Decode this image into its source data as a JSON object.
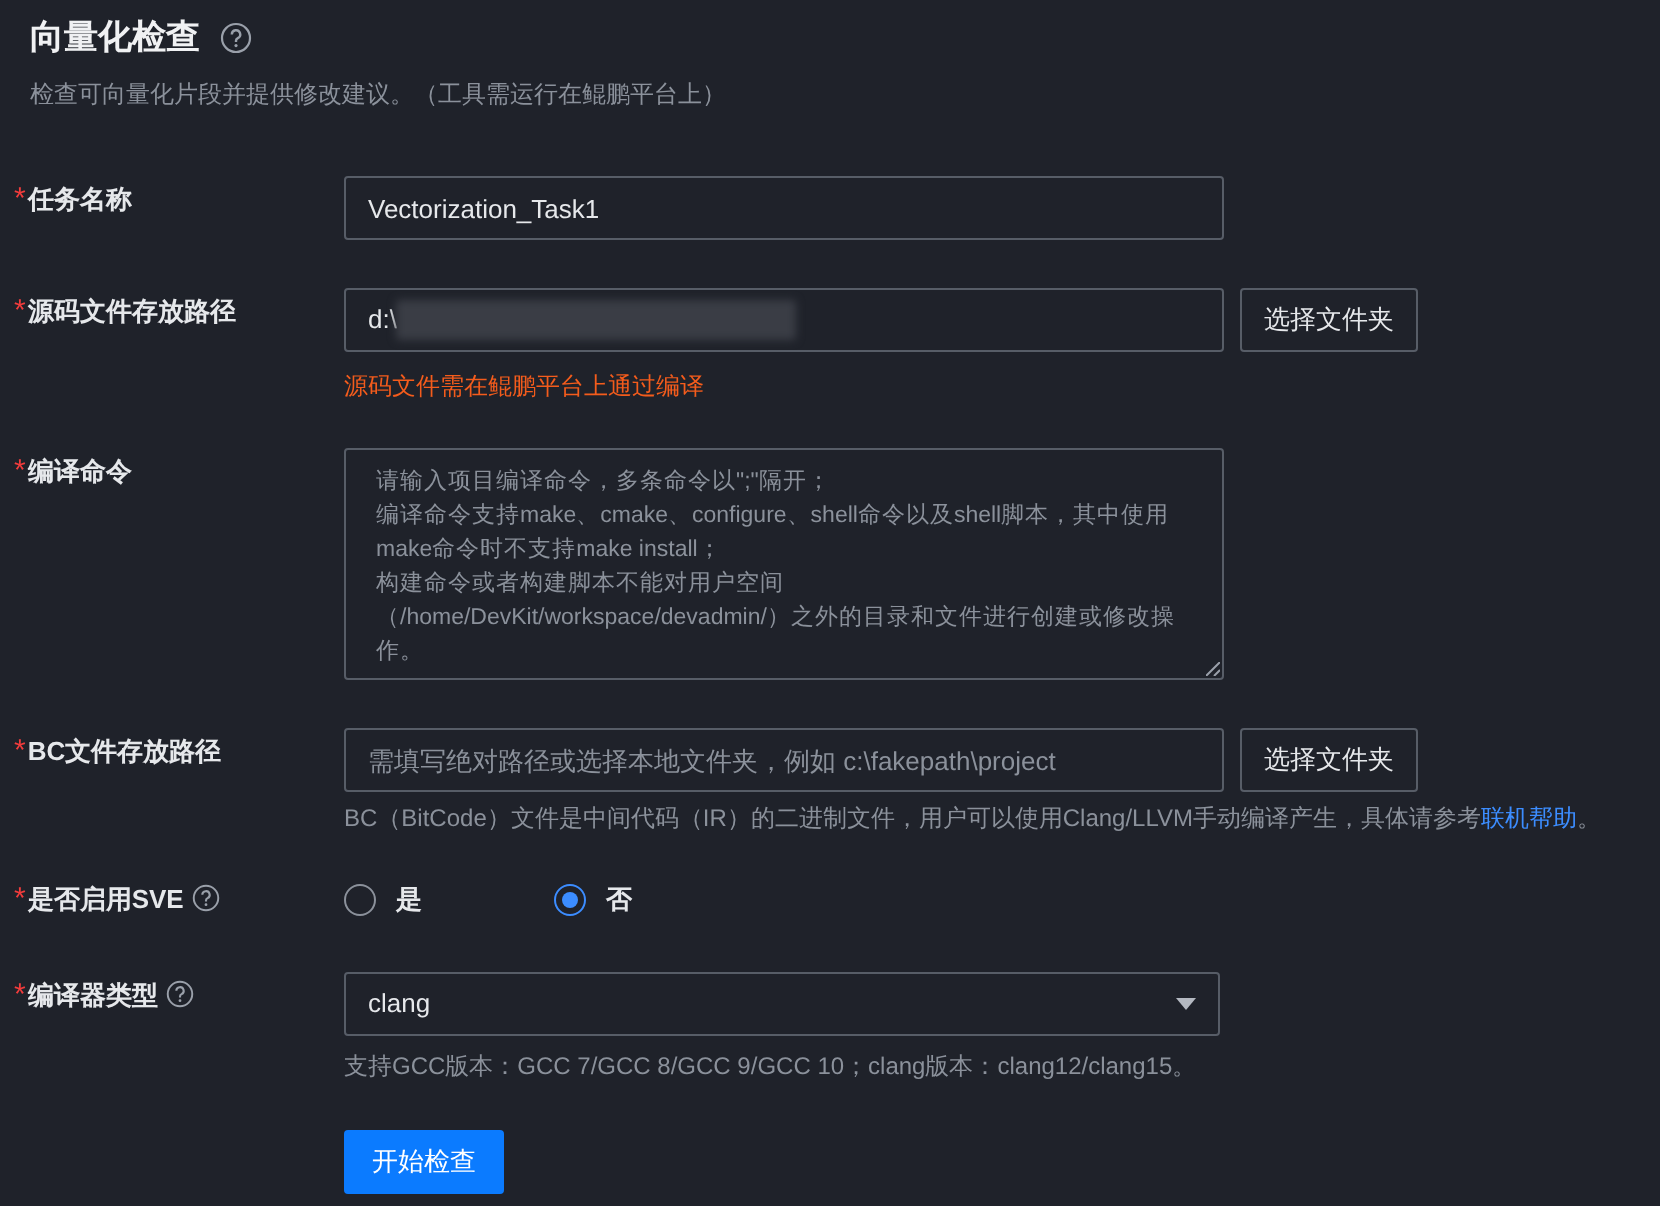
{
  "header": {
    "title": "向量化检查",
    "help": true,
    "subtitle": "检查可向量化片段并提供修改建议。（工具需运行在鲲鹏平台上）"
  },
  "fields": [
    {
      "kind": "input",
      "label": "任务名称",
      "required": true,
      "value": "Vectorization_Task1"
    },
    {
      "kind": "path",
      "label": "源码文件存放路径",
      "required": true,
      "value": "d:\\",
      "redacted": true,
      "button": "选择文件夹",
      "warning": "源码文件需在鲲鹏平台上通过编译"
    },
    {
      "kind": "textarea",
      "label": "编译命令",
      "required": true,
      "placeholder_lines": [
        "请输入项目编译命令，多条命令以\";\"隔开；",
        "编译命令支持make、cmake、configure、shell命令以及shell脚本，其中使用make命令时不支持make install；",
        "构建命令或者构建脚本不能对用户空间（/home/DevKit/workspace/devadmin/）之外的目录和文件进行创建或修改操作。"
      ]
    },
    {
      "kind": "path",
      "label": "BC文件存放路径",
      "required": true,
      "placeholder": "需填写绝对路径或选择本地文件夹，例如 c:\\fakepath\\project",
      "button": "选择文件夹",
      "hint": "BC（BitCode）文件是中间代码（IR）的二进制文件，用户可以使用Clang/LLVM手动编译产生，具体请参考",
      "hint_link": "联机帮助",
      "hint_end": "。"
    },
    {
      "kind": "radio",
      "label": "是否启用SVE",
      "required": true,
      "help": true,
      "options": [
        {
          "label": "是",
          "selected": false
        },
        {
          "label": "否",
          "selected": true
        }
      ]
    },
    {
      "kind": "select",
      "label": "编译器类型",
      "required": true,
      "help": true,
      "value": "clang",
      "hint": "支持GCC版本：GCC 7/GCC 8/GCC 9/GCC 10；clang版本：clang12/clang15。"
    }
  ],
  "submit": "开始检查",
  "required_mark": "*"
}
